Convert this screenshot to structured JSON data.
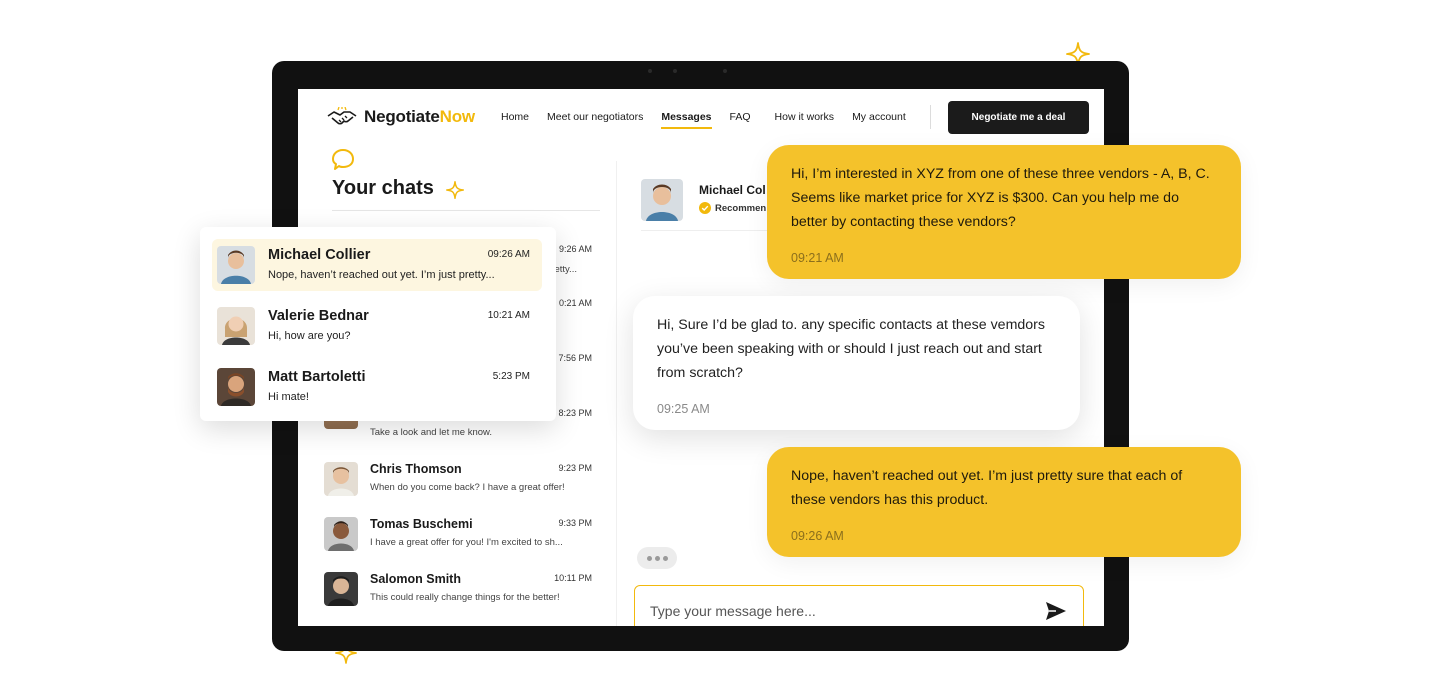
{
  "brand": {
    "name_part1": "Negotiate",
    "name_part2": "Now",
    "accent_color": "#f2b90d",
    "logo_icon": "handshake-icon"
  },
  "nav": {
    "items": [
      {
        "label": "Home",
        "active": false
      },
      {
        "label": "Meet our negotiators",
        "active": false
      },
      {
        "label": "Messages",
        "active": true
      },
      {
        "label": "FAQ",
        "active": false
      },
      {
        "label": "How it works",
        "active": false
      },
      {
        "label": "My account",
        "active": false
      }
    ],
    "cta_label": "Negotiate me a deal"
  },
  "chats": {
    "title": "Your chats",
    "background_list": [
      {
        "name": "",
        "time": "9:26 AM",
        "message": "pretty..."
      },
      {
        "name": "",
        "time": "0:21 AM",
        "message": ""
      },
      {
        "name": "",
        "time": "7:56 PM",
        "message": ""
      },
      {
        "name": "",
        "time": "8:23 PM",
        "message": "Take a look and let me know."
      },
      {
        "name": "Chris Thomson",
        "time": "9:23 PM",
        "message": "When do you come back? I have a great offer!"
      },
      {
        "name": "Tomas Buschemi",
        "time": "9:33 PM",
        "message": "I have a great offer for you! I'm excited to sh..."
      },
      {
        "name": "Salomon Smith",
        "time": "10:11 PM",
        "message": "This could really change things for the better!"
      }
    ],
    "featured": [
      {
        "name": "Michael Collier",
        "time": "09:26 AM",
        "message": "Nope, haven’t reached out yet. I’m just pretty...",
        "active": true
      },
      {
        "name": "Valerie Bednar",
        "time": "10:21 AM",
        "message": "Hi, how are you?",
        "active": false
      },
      {
        "name": "Matt Bartoletti",
        "time": "5:23 PM",
        "message": "Hi mate!",
        "active": false
      }
    ]
  },
  "conversation": {
    "contact_name": "Michael Col",
    "badge": "Recommen",
    "messages": [
      {
        "from": "me",
        "text": "Hi, I’m interested in XYZ from one of these three vendors - A, B, C. Seems like market price for XYZ is $300. Can you help me do better by contacting these vendors?",
        "time": "09:21 AM"
      },
      {
        "from": "negotiator",
        "text": "Hi, Sure I’d be glad to. any specific contacts at these vemdors you’ve been speaking with or should I just reach out and start from scratch?",
        "time": "09:25 AM"
      },
      {
        "from": "me",
        "text": "Nope, haven’t reached out yet. I’m just pretty sure that each of these vendors has this product.",
        "time": "09:26 AM"
      }
    ],
    "composer_placeholder": "Type your message here...",
    "send_icon": "send-icon"
  }
}
